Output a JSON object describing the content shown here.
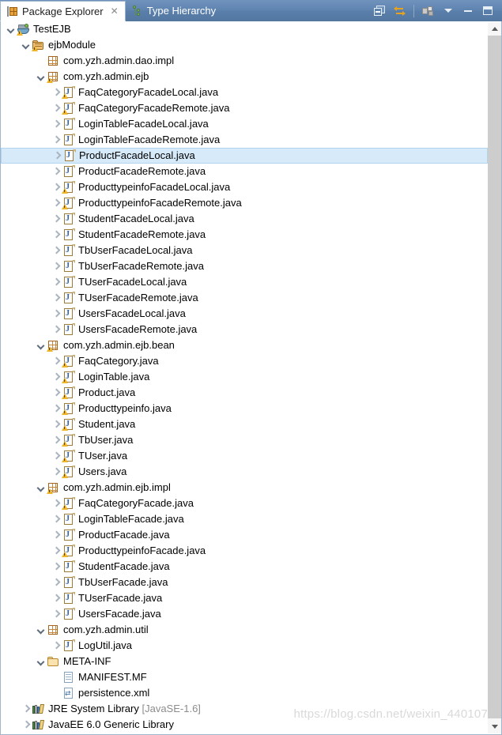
{
  "window": {
    "tabs": [
      {
        "label": "Package Explorer",
        "icon": "package-explorer-icon",
        "active": true,
        "closable": true,
        "close_glyph": "✕"
      },
      {
        "label": "Type Hierarchy",
        "icon": "type-hierarchy-icon",
        "active": false,
        "closable": false,
        "close_glyph": ""
      }
    ],
    "toolbar": [
      {
        "name": "collapse-all-button",
        "title": "Collapse All"
      },
      {
        "name": "link-with-editor-button",
        "title": "Link with Editor"
      },
      {
        "name": "view-menu-button",
        "title": "View Menu"
      },
      {
        "name": "view-dropdown-button",
        "title": "Open Menu"
      },
      {
        "name": "minimize-button",
        "title": "Minimize"
      },
      {
        "name": "maximize-button",
        "title": "Maximize"
      }
    ]
  },
  "watermark": "https://blog.csdn.net/weixin_440107",
  "scrollbar": {
    "up_label": "",
    "down_label": ""
  },
  "tree": [
    {
      "depth": 0,
      "twisty": "open",
      "icon": "project-icon",
      "warn": true,
      "label": "TestEJB",
      "selected": false
    },
    {
      "depth": 1,
      "twisty": "open",
      "icon": "source-folder-icon",
      "warn": true,
      "label": "ejbModule",
      "selected": false
    },
    {
      "depth": 2,
      "twisty": "none",
      "icon": "package-icon",
      "warn": false,
      "label": "com.yzh.admin.dao.impl",
      "selected": false
    },
    {
      "depth": 2,
      "twisty": "open",
      "icon": "package-icon",
      "warn": true,
      "label": "com.yzh.admin.ejb",
      "selected": false
    },
    {
      "depth": 3,
      "twisty": "closed",
      "icon": "java-file-icon",
      "warn": true,
      "label": "FaqCategoryFacadeLocal.java",
      "selected": false
    },
    {
      "depth": 3,
      "twisty": "closed",
      "icon": "java-file-icon",
      "warn": true,
      "label": "FaqCategoryFacadeRemote.java",
      "selected": false
    },
    {
      "depth": 3,
      "twisty": "closed",
      "icon": "java-file-icon",
      "warn": false,
      "label": "LoginTableFacadeLocal.java",
      "selected": false
    },
    {
      "depth": 3,
      "twisty": "closed",
      "icon": "java-file-icon",
      "warn": false,
      "label": "LoginTableFacadeRemote.java",
      "selected": false
    },
    {
      "depth": 3,
      "twisty": "closed",
      "icon": "java-file-icon",
      "warn": false,
      "label": "ProductFacadeLocal.java",
      "selected": true
    },
    {
      "depth": 3,
      "twisty": "closed",
      "icon": "java-file-icon",
      "warn": false,
      "label": "ProductFacadeRemote.java",
      "selected": false
    },
    {
      "depth": 3,
      "twisty": "closed",
      "icon": "java-file-icon",
      "warn": true,
      "label": "ProducttypeinfoFacadeLocal.java",
      "selected": false
    },
    {
      "depth": 3,
      "twisty": "closed",
      "icon": "java-file-icon",
      "warn": true,
      "label": "ProducttypeinfoFacadeRemote.java",
      "selected": false
    },
    {
      "depth": 3,
      "twisty": "closed",
      "icon": "java-file-icon",
      "warn": false,
      "label": "StudentFacadeLocal.java",
      "selected": false
    },
    {
      "depth": 3,
      "twisty": "closed",
      "icon": "java-file-icon",
      "warn": false,
      "label": "StudentFacadeRemote.java",
      "selected": false
    },
    {
      "depth": 3,
      "twisty": "closed",
      "icon": "java-file-icon",
      "warn": false,
      "label": "TbUserFacadeLocal.java",
      "selected": false
    },
    {
      "depth": 3,
      "twisty": "closed",
      "icon": "java-file-icon",
      "warn": false,
      "label": "TbUserFacadeRemote.java",
      "selected": false
    },
    {
      "depth": 3,
      "twisty": "closed",
      "icon": "java-file-icon",
      "warn": false,
      "label": "TUserFacadeLocal.java",
      "selected": false
    },
    {
      "depth": 3,
      "twisty": "closed",
      "icon": "java-file-icon",
      "warn": false,
      "label": "TUserFacadeRemote.java",
      "selected": false
    },
    {
      "depth": 3,
      "twisty": "closed",
      "icon": "java-file-icon",
      "warn": false,
      "label": "UsersFacadeLocal.java",
      "selected": false
    },
    {
      "depth": 3,
      "twisty": "closed",
      "icon": "java-file-icon",
      "warn": false,
      "label": "UsersFacadeRemote.java",
      "selected": false
    },
    {
      "depth": 2,
      "twisty": "open",
      "icon": "package-icon",
      "warn": true,
      "label": "com.yzh.admin.ejb.bean",
      "selected": false
    },
    {
      "depth": 3,
      "twisty": "closed",
      "icon": "java-file-icon",
      "warn": true,
      "label": "FaqCategory.java",
      "selected": false
    },
    {
      "depth": 3,
      "twisty": "closed",
      "icon": "java-file-icon",
      "warn": true,
      "label": "LoginTable.java",
      "selected": false
    },
    {
      "depth": 3,
      "twisty": "closed",
      "icon": "java-file-icon",
      "warn": true,
      "label": "Product.java",
      "selected": false
    },
    {
      "depth": 3,
      "twisty": "closed",
      "icon": "java-file-icon",
      "warn": true,
      "label": "Producttypeinfo.java",
      "selected": false
    },
    {
      "depth": 3,
      "twisty": "closed",
      "icon": "java-file-icon",
      "warn": true,
      "label": "Student.java",
      "selected": false
    },
    {
      "depth": 3,
      "twisty": "closed",
      "icon": "java-file-icon",
      "warn": true,
      "label": "TbUser.java",
      "selected": false
    },
    {
      "depth": 3,
      "twisty": "closed",
      "icon": "java-file-icon",
      "warn": true,
      "label": "TUser.java",
      "selected": false
    },
    {
      "depth": 3,
      "twisty": "closed",
      "icon": "java-file-icon",
      "warn": true,
      "label": "Users.java",
      "selected": false
    },
    {
      "depth": 2,
      "twisty": "open",
      "icon": "package-icon",
      "warn": true,
      "label": "com.yzh.admin.ejb.impl",
      "selected": false
    },
    {
      "depth": 3,
      "twisty": "closed",
      "icon": "java-file-icon",
      "warn": true,
      "label": "FaqCategoryFacade.java",
      "selected": false
    },
    {
      "depth": 3,
      "twisty": "closed",
      "icon": "java-file-icon",
      "warn": false,
      "label": "LoginTableFacade.java",
      "selected": false
    },
    {
      "depth": 3,
      "twisty": "closed",
      "icon": "java-file-icon",
      "warn": false,
      "label": "ProductFacade.java",
      "selected": false
    },
    {
      "depth": 3,
      "twisty": "closed",
      "icon": "java-file-icon",
      "warn": true,
      "label": "ProducttypeinfoFacade.java",
      "selected": false
    },
    {
      "depth": 3,
      "twisty": "closed",
      "icon": "java-file-icon",
      "warn": false,
      "label": "StudentFacade.java",
      "selected": false
    },
    {
      "depth": 3,
      "twisty": "closed",
      "icon": "java-file-icon",
      "warn": false,
      "label": "TbUserFacade.java",
      "selected": false
    },
    {
      "depth": 3,
      "twisty": "closed",
      "icon": "java-file-icon",
      "warn": false,
      "label": "TUserFacade.java",
      "selected": false
    },
    {
      "depth": 3,
      "twisty": "closed",
      "icon": "java-file-icon",
      "warn": false,
      "label": "UsersFacade.java",
      "selected": false
    },
    {
      "depth": 2,
      "twisty": "open",
      "icon": "package-icon",
      "warn": false,
      "label": "com.yzh.admin.util",
      "selected": false
    },
    {
      "depth": 3,
      "twisty": "closed",
      "icon": "java-file-icon",
      "warn": false,
      "label": "LogUtil.java",
      "selected": false
    },
    {
      "depth": 2,
      "twisty": "open",
      "icon": "folder-icon",
      "warn": false,
      "label": "META-INF",
      "selected": false
    },
    {
      "depth": 3,
      "twisty": "none",
      "icon": "text-file-icon",
      "warn": false,
      "label": "MANIFEST.MF",
      "selected": false
    },
    {
      "depth": 3,
      "twisty": "none",
      "icon": "xml-file-icon",
      "warn": false,
      "label": "persistence.xml",
      "selected": false
    },
    {
      "depth": 1,
      "twisty": "closed",
      "icon": "library-icon",
      "warn": false,
      "label": "JRE System Library ",
      "dim": "[JavaSE-1.6]",
      "selected": false
    },
    {
      "depth": 1,
      "twisty": "closed",
      "icon": "library-icon",
      "warn": false,
      "label": "JavaEE 6.0 Generic Library",
      "selected": false
    }
  ]
}
